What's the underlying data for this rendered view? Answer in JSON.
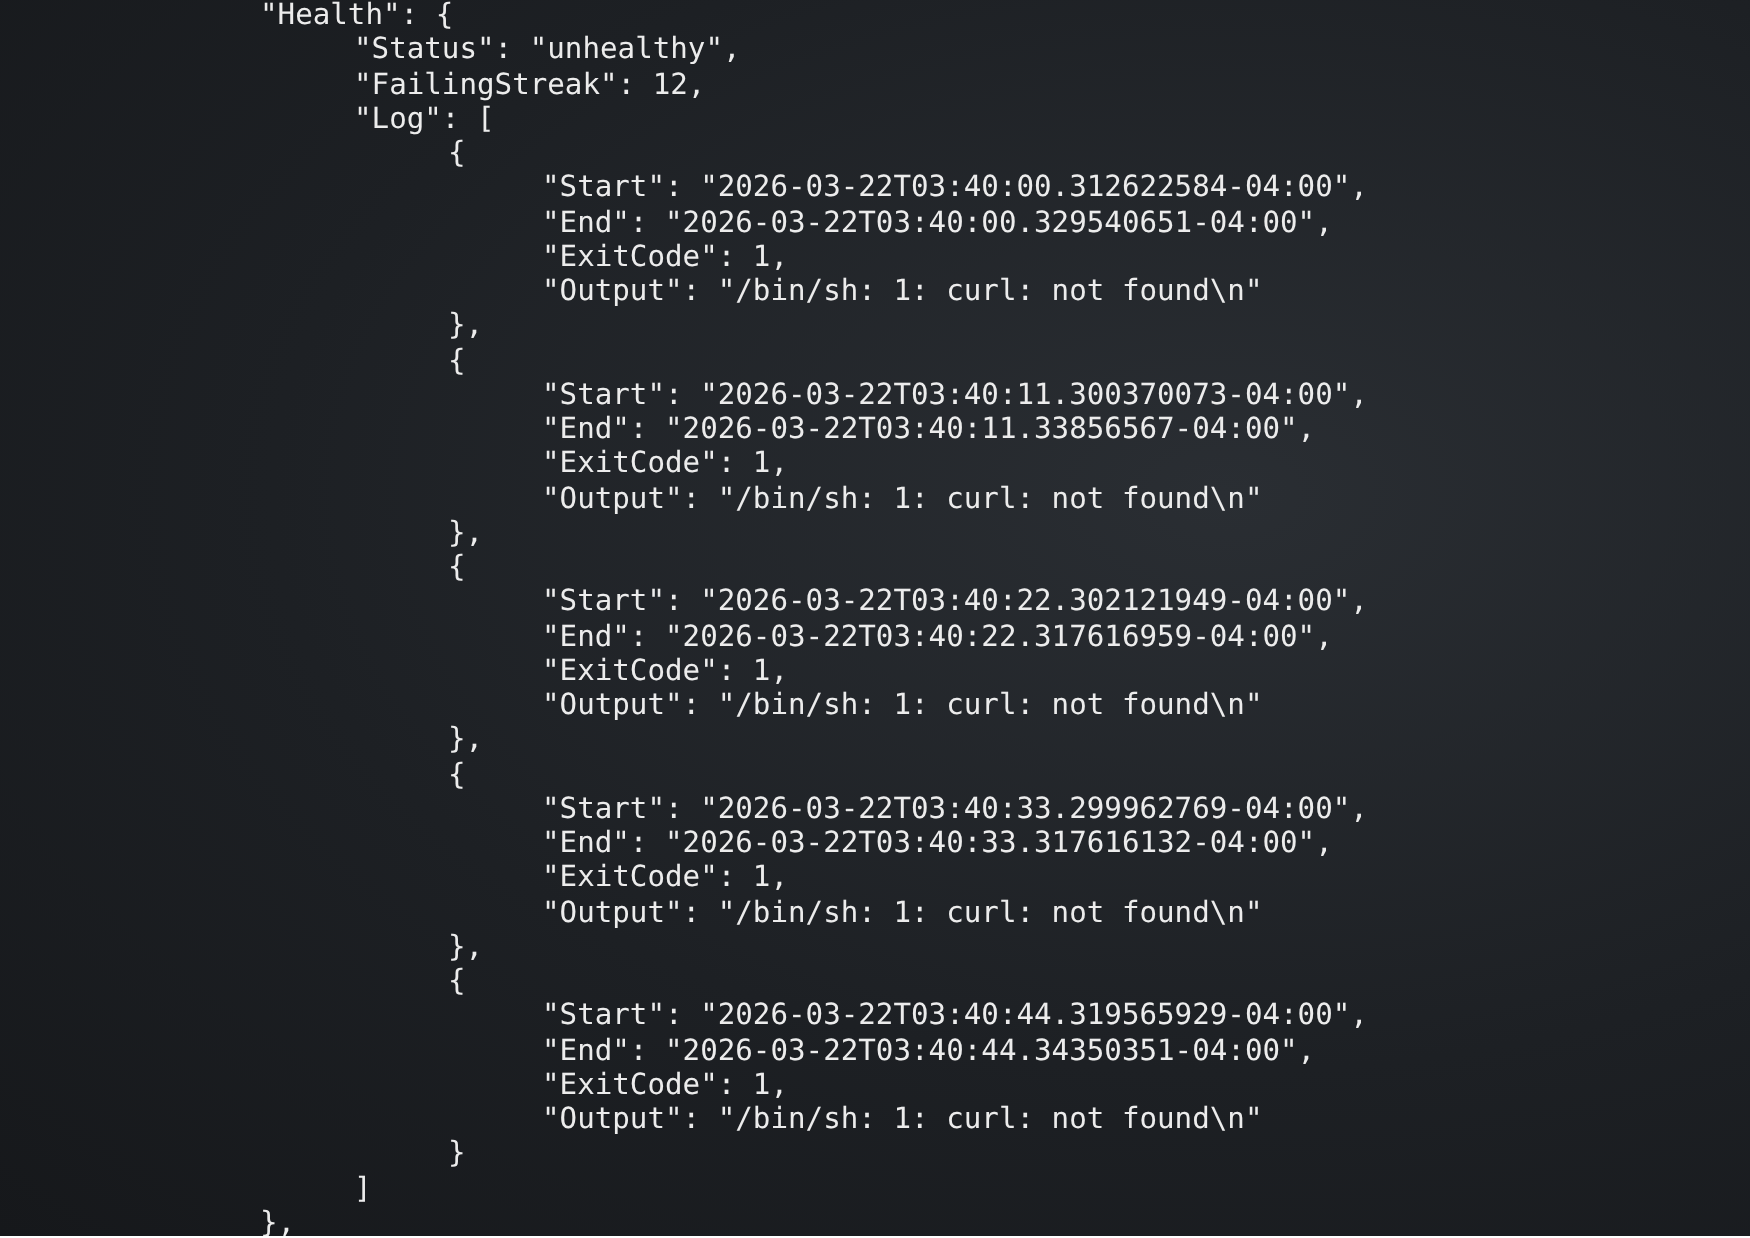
{
  "terminal_lines": [
    "\t\"Health\": {",
    "\t\t\"Status\": \"unhealthy\",",
    "\t\t\"FailingStreak\": 12,",
    "\t\t\"Log\": [",
    "\t\t\t{",
    "\t\t\t\t\"Start\": \"2026-03-22T03:40:00.312622584-04:00\",",
    "\t\t\t\t\"End\": \"2026-03-22T03:40:00.329540651-04:00\",",
    "\t\t\t\t\"ExitCode\": 1,",
    "\t\t\t\t\"Output\": \"/bin/sh: 1: curl: not found\\n\"",
    "\t\t\t},",
    "\t\t\t{",
    "\t\t\t\t\"Start\": \"2026-03-22T03:40:11.300370073-04:00\",",
    "\t\t\t\t\"End\": \"2026-03-22T03:40:11.33856567-04:00\",",
    "\t\t\t\t\"ExitCode\": 1,",
    "\t\t\t\t\"Output\": \"/bin/sh: 1: curl: not found\\n\"",
    "\t\t\t},",
    "\t\t\t{",
    "\t\t\t\t\"Start\": \"2026-03-22T03:40:22.302121949-04:00\",",
    "\t\t\t\t\"End\": \"2026-03-22T03:40:22.317616959-04:00\",",
    "\t\t\t\t\"ExitCode\": 1,",
    "\t\t\t\t\"Output\": \"/bin/sh: 1: curl: not found\\n\"",
    "\t\t\t},",
    "\t\t\t{",
    "\t\t\t\t\"Start\": \"2026-03-22T03:40:33.299962769-04:00\",",
    "\t\t\t\t\"End\": \"2026-03-22T03:40:33.317616132-04:00\",",
    "\t\t\t\t\"ExitCode\": 1,",
    "\t\t\t\t\"Output\": \"/bin/sh: 1: curl: not found\\n\"",
    "\t\t\t},",
    "\t\t\t{",
    "\t\t\t\t\"Start\": \"2026-03-22T03:40:44.319565929-04:00\",",
    "\t\t\t\t\"End\": \"2026-03-22T03:40:44.34350351-04:00\",",
    "\t\t\t\t\"ExitCode\": 1,",
    "\t\t\t\t\"Output\": \"/bin/sh: 1: curl: not found\\n\"",
    "\t\t\t}",
    "\t\t]",
    "\t},"
  ]
}
